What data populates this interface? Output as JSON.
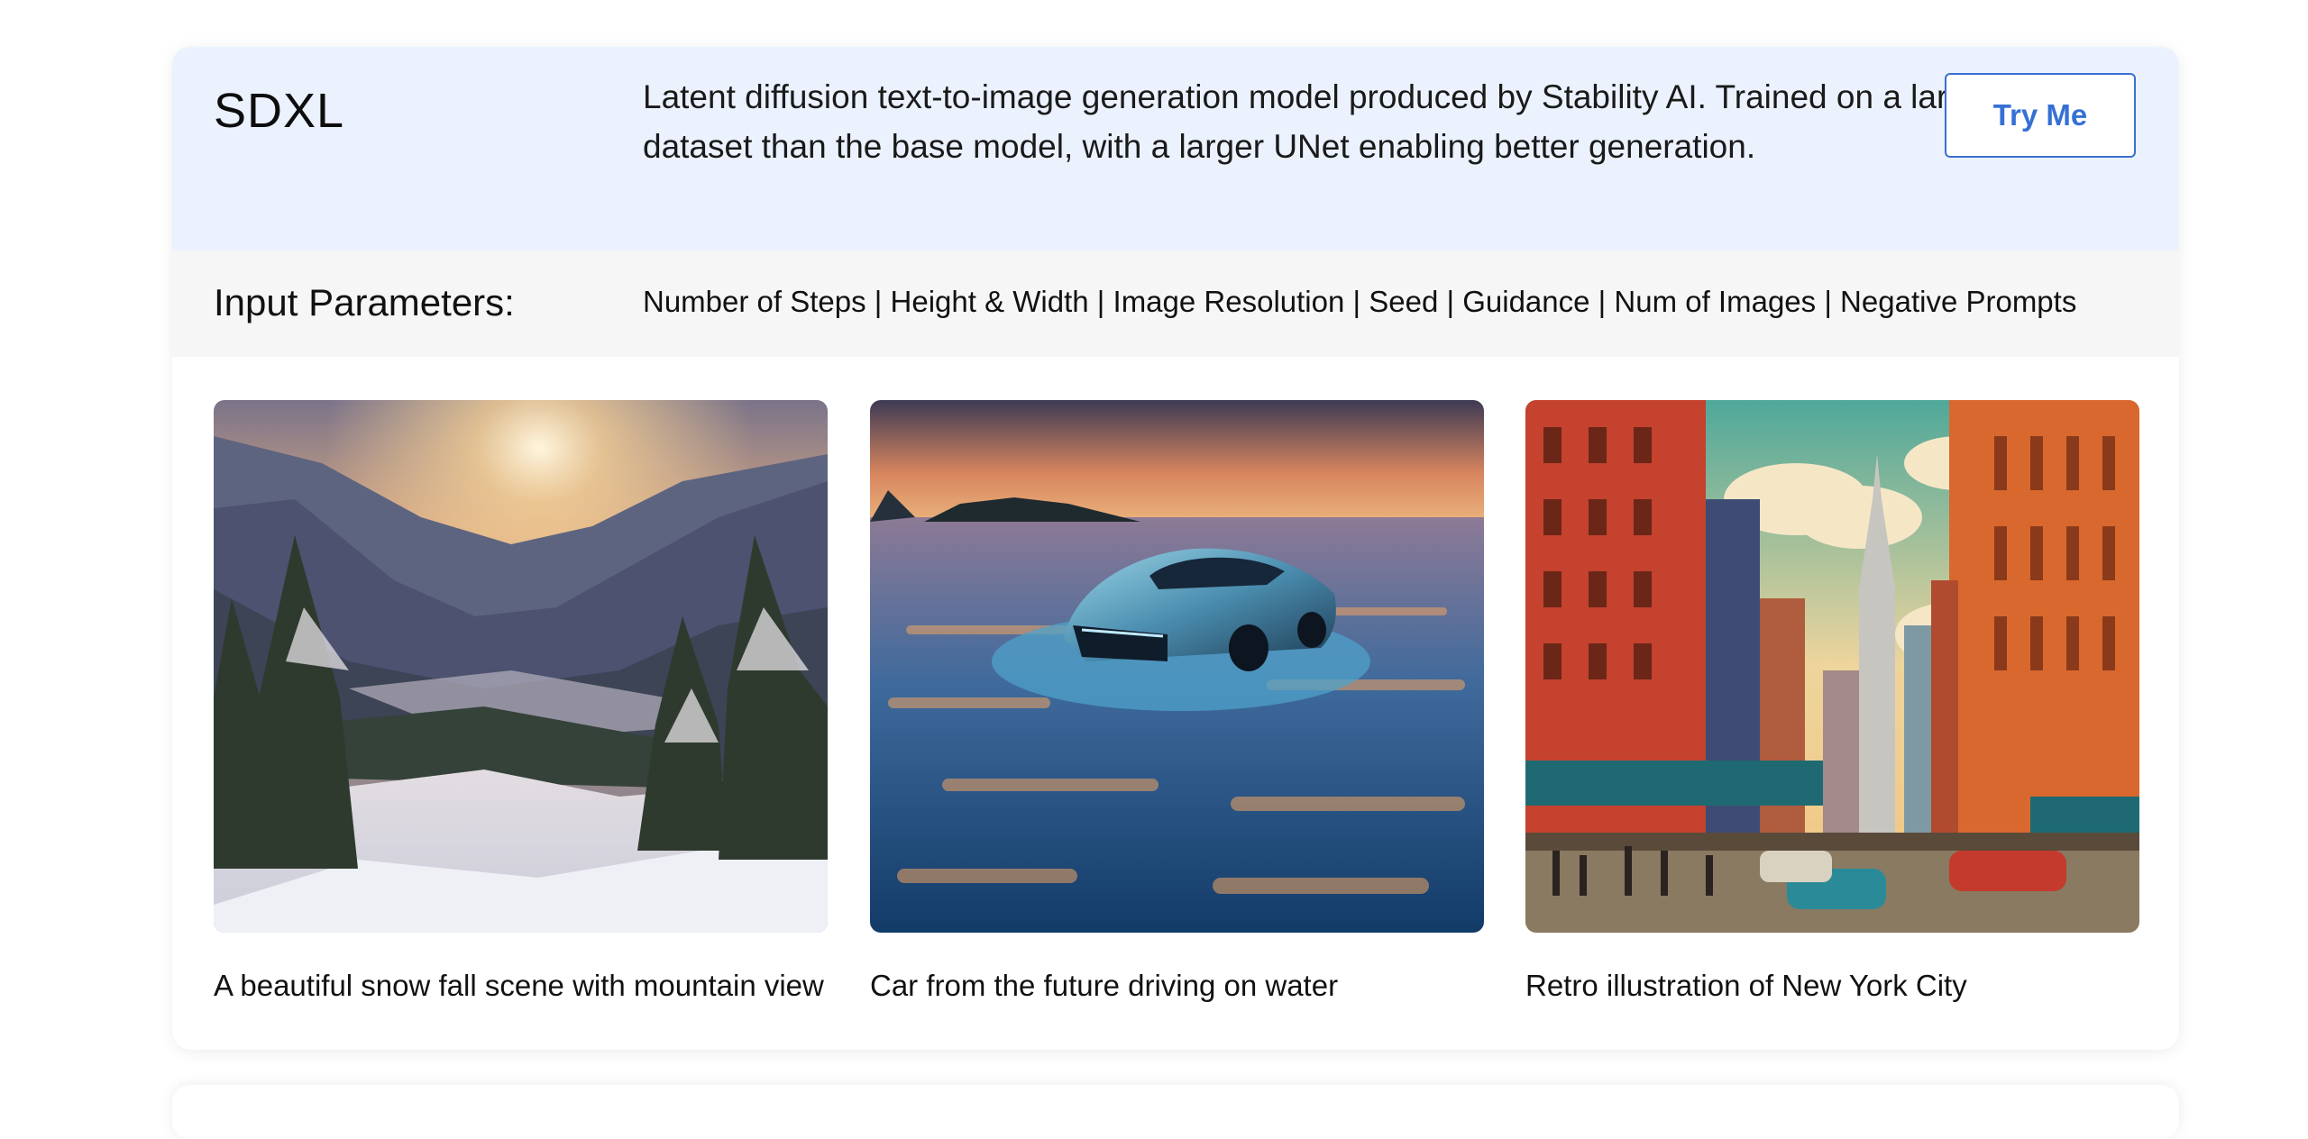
{
  "model": {
    "name": "SDXL",
    "description": "Latent diffusion text-to-image generation model produced by Stability AI. Trained on a larger dataset than the base model, with a larger UNet enabling better generation.",
    "try_label": "Try Me"
  },
  "params": {
    "label": "Input Parameters:",
    "list": "Number of Steps | Height & Width | Image Resolution | Seed | Guidance | Num of Images | Negative Prompts"
  },
  "gallery": [
    {
      "caption": "A beautiful snow fall scene with mountain view",
      "image": "snowy-mountain-sunset-image"
    },
    {
      "caption": "Car from the future driving on water",
      "image": "futuristic-car-on-water-image"
    },
    {
      "caption": "Retro illustration of New York City",
      "image": "retro-new-york-city-image"
    }
  ],
  "colors": {
    "header_bg": "#ebf2fe",
    "params_bg": "#f6f6f6",
    "accent": "#3570d5"
  }
}
